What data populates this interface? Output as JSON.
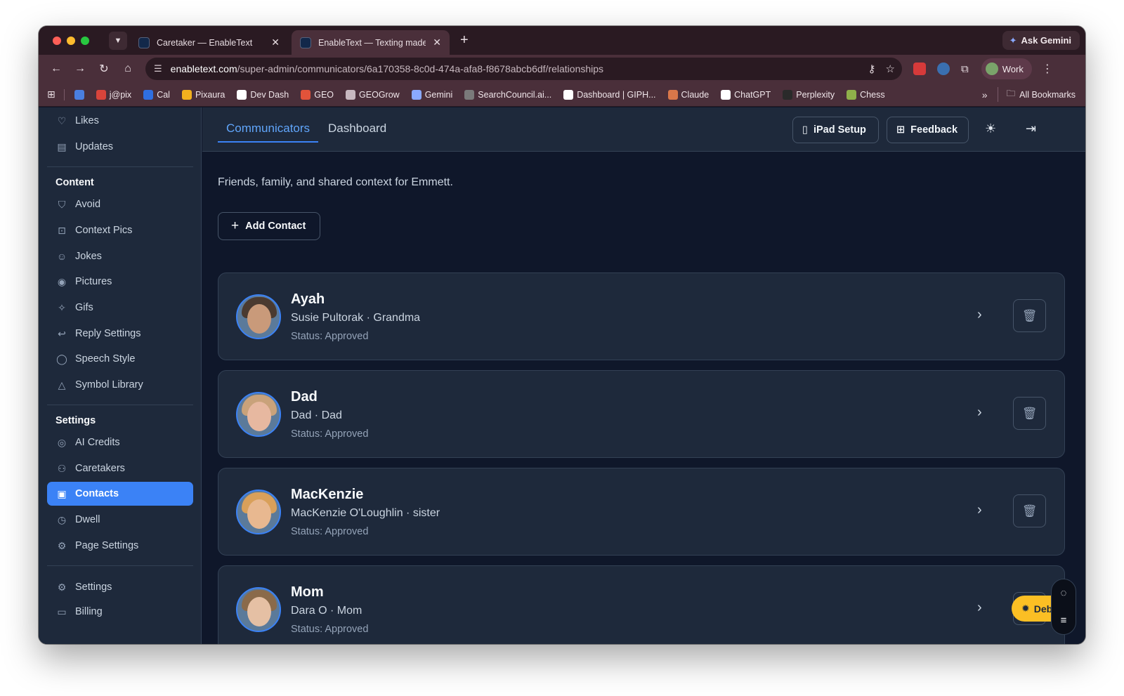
{
  "browser": {
    "tabs": [
      {
        "title": "Caretaker — EnableText",
        "active": false
      },
      {
        "title": "EnableText — Texting made e",
        "active": true
      }
    ],
    "ask_gemini": "Ask Gemini",
    "url_host": "enabletext.com",
    "url_path": "/super-admin/communicators/6a170358-8c0d-474a-afa8-f8678abcb6df/relationships",
    "profile_label": "Work",
    "bookmarks": [
      {
        "label": "",
        "color": "#4a7fe0"
      },
      {
        "label": "j@pix",
        "color": "#d9443b"
      },
      {
        "label": "Cal",
        "color": "#2f6fe0"
      },
      {
        "label": "Pixaura",
        "color": "#f2b01e"
      },
      {
        "label": "Dev Dash",
        "color": "#ffffff"
      },
      {
        "label": "GEO",
        "color": "#e2533a"
      },
      {
        "label": "GEOGrow",
        "color": "#c7b8bf"
      },
      {
        "label": "Gemini",
        "color": "#8aa9ff"
      },
      {
        "label": "SearchCouncil.ai...",
        "color": "#7a7a7a"
      },
      {
        "label": "Dashboard | GIPH...",
        "color": "#ffffff"
      },
      {
        "label": "Claude",
        "color": "#d9774a"
      },
      {
        "label": "ChatGPT",
        "color": "#ffffff"
      },
      {
        "label": "Perplexity",
        "color": "#2a2a2a"
      },
      {
        "label": "Chess",
        "color": "#8fb04a"
      }
    ],
    "all_bookmarks": "All Bookmarks"
  },
  "sidebar": {
    "top_items": [
      {
        "label": "Likes",
        "icon": "heart-icon"
      },
      {
        "label": "Updates",
        "icon": "newspaper-icon"
      }
    ],
    "content_heading": "Content",
    "content_items": [
      {
        "label": "Avoid",
        "icon": "shield-icon"
      },
      {
        "label": "Context Pics",
        "icon": "image-plus-icon"
      },
      {
        "label": "Jokes",
        "icon": "smile-icon"
      },
      {
        "label": "Pictures",
        "icon": "camera-icon"
      },
      {
        "label": "Gifs",
        "icon": "sparkles-icon"
      },
      {
        "label": "Reply Settings",
        "icon": "reply-icon"
      },
      {
        "label": "Speech Style",
        "icon": "speech-bubble-icon"
      },
      {
        "label": "Symbol Library",
        "icon": "shapes-icon"
      }
    ],
    "settings_heading": "Settings",
    "settings_items": [
      {
        "label": "AI Credits",
        "icon": "coins-icon"
      },
      {
        "label": "Caretakers",
        "icon": "users-icon"
      },
      {
        "label": "Contacts",
        "icon": "contact-book-icon",
        "active": true
      },
      {
        "label": "Dwell",
        "icon": "timer-icon"
      },
      {
        "label": "Page Settings",
        "icon": "gear-icon"
      }
    ],
    "bottom_items": [
      {
        "label": "Settings",
        "icon": "gear-icon"
      },
      {
        "label": "Billing",
        "icon": "credit-card-icon"
      }
    ]
  },
  "topbar": {
    "tabs": [
      {
        "label": "Communicators",
        "active": true
      },
      {
        "label": "Dashboard",
        "active": false
      }
    ],
    "ipad_setup": "iPad Setup",
    "feedback": "Feedback"
  },
  "main": {
    "subtitle": "Friends, family, and shared context for Emmett.",
    "add_contact": "Add Contact",
    "contacts": [
      {
        "name": "Ayah",
        "detail": "Susie Pultorak · Grandma",
        "status": "Status: Approved",
        "skin": "#c99a7a",
        "hair": "#4a3a30"
      },
      {
        "name": "Dad",
        "detail": "Dad · Dad",
        "status": "Status: Approved",
        "skin": "#e7b8a0",
        "hair": "#c9a27a"
      },
      {
        "name": "MacKenzie",
        "detail": "MacKenzie O'Loughlin · sister",
        "status": "Status: Approved",
        "skin": "#e8b890",
        "hair": "#d9a05a"
      },
      {
        "name": "Mom",
        "detail": "Dara O · Mom",
        "status": "Status: Approved",
        "skin": "#e5c0a4",
        "hair": "#8a6a4a"
      }
    ]
  },
  "widgets": {
    "debug_label": "Deb"
  }
}
